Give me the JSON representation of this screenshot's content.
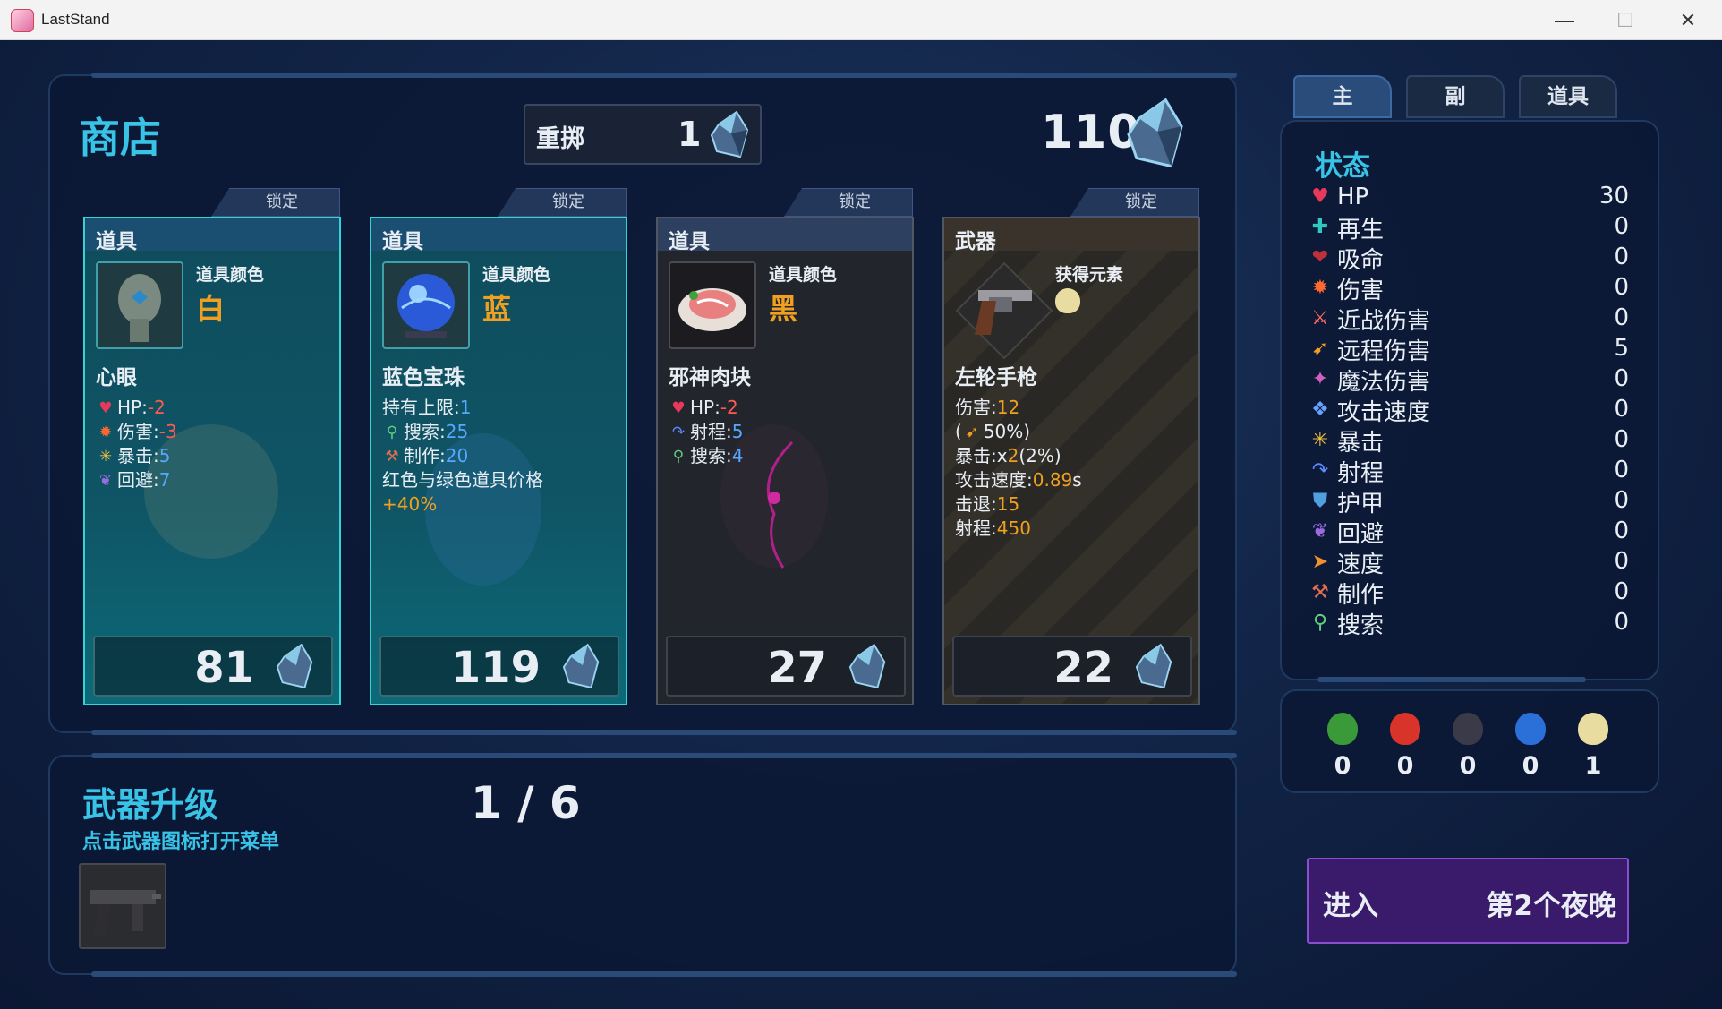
{
  "window": {
    "title": "LastStand",
    "minimize": "—",
    "maximize": "☐",
    "close": "✕"
  },
  "shop": {
    "title": "商店",
    "reroll_label": "重掷",
    "reroll_cost": "1",
    "money": "110",
    "lock_label": "锁定",
    "cards": [
      {
        "type": "道具",
        "color_label": "道具颜色",
        "color": "白",
        "name": "心眼",
        "price": "81",
        "style": "blue",
        "icon": "mind-eye-head-icon",
        "stats": [
          {
            "icon": "heart-icon",
            "label": "HP:",
            "value": "-2",
            "cls": "red"
          },
          {
            "icon": "damage-icon",
            "label": "伤害:",
            "value": "-3",
            "cls": "red"
          },
          {
            "icon": "crit-icon",
            "label": "暴击:",
            "value": "5",
            "cls": "bluev"
          },
          {
            "icon": "dodge-icon",
            "label": "回避:",
            "value": "7",
            "cls": "bluev"
          }
        ]
      },
      {
        "type": "道具",
        "color_label": "道具颜色",
        "color": "蓝",
        "name": "蓝色宝珠",
        "price": "119",
        "style": "blue",
        "icon": "blue-orb-icon",
        "stats": [
          {
            "icon": "",
            "label": "持有上限:",
            "value": "1",
            "cls": "bluev"
          },
          {
            "icon": "search-icon",
            "label": "搜索:",
            "value": "25",
            "cls": "bluev"
          },
          {
            "icon": "craft-icon",
            "label": "制作:",
            "value": "20",
            "cls": "bluev"
          },
          {
            "icon": "",
            "label": "红色与绿色道具价格",
            "value": "",
            "cls": ""
          },
          {
            "icon": "",
            "label": "",
            "value": "+40%",
            "cls": "orange"
          }
        ]
      },
      {
        "type": "道具",
        "color_label": "道具颜色",
        "color": "黑",
        "name": "邪神肉块",
        "price": "27",
        "style": "dark",
        "icon": "meat-chunk-icon",
        "stats": [
          {
            "icon": "heart-icon",
            "label": "HP:",
            "value": "-2",
            "cls": "red"
          },
          {
            "icon": "range-icon",
            "label": "射程:",
            "value": "5",
            "cls": "bluev"
          },
          {
            "icon": "search-icon",
            "label": "搜索:",
            "value": "4",
            "cls": "bluev"
          }
        ]
      },
      {
        "type": "武器",
        "color_label": "获得元素",
        "color": "",
        "name": "左轮手枪",
        "price": "22",
        "style": "weapon",
        "icon": "revolver-icon",
        "stats": [
          {
            "icon": "",
            "label": "伤害:",
            "value": "12",
            "cls": "orange"
          },
          {
            "icon": "",
            "label": "(",
            "value": "",
            "cls": ""
          },
          {
            "icon": "",
            "label": "暴击:x",
            "value": "2",
            "cls": "orange"
          },
          {
            "icon": "",
            "label": "攻击速度:",
            "value": "0.89",
            "cls": "orange"
          },
          {
            "icon": "",
            "label": "击退:",
            "value": "15",
            "cls": "orange"
          },
          {
            "icon": "",
            "label": "射程:",
            "value": "450",
            "cls": "orange"
          }
        ]
      }
    ]
  },
  "weapon_extra": {
    "ranged_pct": "50%)",
    "crit_pct": "(2%)",
    "speed_unit": "s"
  },
  "upgrade": {
    "title": "武器升级",
    "subtitle": "点击武器图标打开菜单",
    "count": "1 / 6"
  },
  "tabs": [
    "主",
    "副",
    "道具"
  ],
  "status": {
    "title": "状态",
    "rows": [
      {
        "icon": "heart-icon",
        "label": "HP",
        "value": "30",
        "color": "#e8395a"
      },
      {
        "icon": "regen-icon",
        "label": "再生",
        "value": "0",
        "color": "#30c8c0"
      },
      {
        "icon": "lifesteal-icon",
        "label": "吸命",
        "value": "0",
        "color": "#c0303a"
      },
      {
        "icon": "damage-icon",
        "label": "伤害",
        "value": "0",
        "color": "#ff6a30"
      },
      {
        "icon": "melee-icon",
        "label": "近战伤害",
        "value": "0",
        "color": "#ff6a60"
      },
      {
        "icon": "ranged-icon",
        "label": "远程伤害",
        "value": "5",
        "color": "#f0a020"
      },
      {
        "icon": "magic-icon",
        "label": "魔法伤害",
        "value": "0",
        "color": "#d060c0"
      },
      {
        "icon": "attack-speed-icon",
        "label": "攻击速度",
        "value": "0",
        "color": "#6aa0ff"
      },
      {
        "icon": "crit-icon",
        "label": "暴击",
        "value": "0",
        "color": "#f0c040"
      },
      {
        "icon": "range-icon",
        "label": "射程",
        "value": "0",
        "color": "#5a8aff"
      },
      {
        "icon": "armor-icon",
        "label": "护甲",
        "value": "0",
        "color": "#50a0e0"
      },
      {
        "icon": "dodge-icon",
        "label": "回避",
        "value": "0",
        "color": "#9a6ae0"
      },
      {
        "icon": "speed-icon",
        "label": "速度",
        "value": "0",
        "color": "#f09030"
      },
      {
        "icon": "craft-icon",
        "label": "制作",
        "value": "0",
        "color": "#e07050"
      },
      {
        "icon": "search-icon",
        "label": "搜索",
        "value": "0",
        "color": "#60d080"
      }
    ]
  },
  "elements": [
    {
      "icon": "green-element-icon",
      "color": "#3a9a3a",
      "count": "0"
    },
    {
      "icon": "red-element-icon",
      "color": "#d8342a",
      "count": "0"
    },
    {
      "icon": "dark-element-icon",
      "color": "#3a3a48",
      "count": "0"
    },
    {
      "icon": "blue-element-icon",
      "color": "#2a70d8",
      "count": "0"
    },
    {
      "icon": "yellow-element-icon",
      "color": "#e8dca0",
      "count": "1"
    }
  ],
  "enter": {
    "label": "进入",
    "night": "第2个夜晚"
  }
}
